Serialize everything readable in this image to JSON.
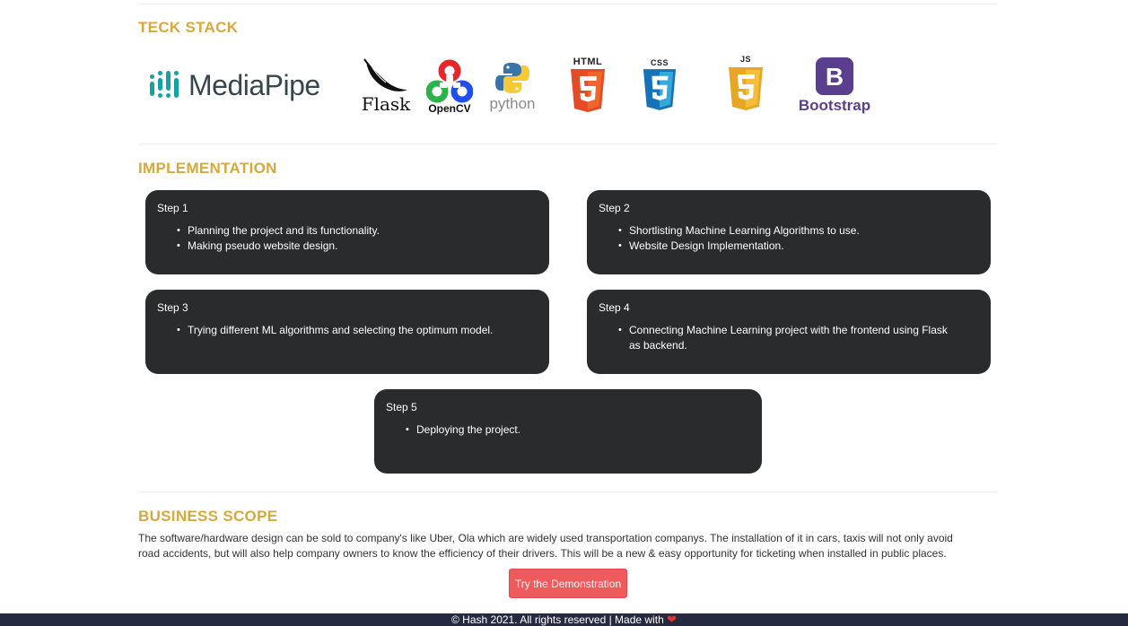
{
  "tech_stack": {
    "title": "TECK STACK",
    "logos": [
      {
        "name": "MediaPipe",
        "icon": "mediapipe-logo"
      },
      {
        "name": "Flask",
        "icon": "flask-logo"
      },
      {
        "name": "OpenCV",
        "icon": "opencv-logo"
      },
      {
        "name": "python",
        "icon": "python-logo"
      },
      {
        "name": "HTML",
        "icon": "html5-logo"
      },
      {
        "name": "CSS",
        "icon": "css3-logo"
      },
      {
        "name": "JS",
        "icon": "js-logo"
      },
      {
        "name": "Bootstrap",
        "icon": "bootstrap-logo"
      }
    ]
  },
  "implementation": {
    "title": "IMPLEMENTATION",
    "steps": [
      {
        "title": "Step 1",
        "items": [
          "Planning the project and its functionality.",
          "Making pseudo website design."
        ]
      },
      {
        "title": "Step 2",
        "items": [
          "Shortlisting Machine Learning Algorithms to use.",
          "Website Design Implementation."
        ]
      },
      {
        "title": "Step 3",
        "items": [
          "Trying different ML algorithms and selecting the optimum model."
        ]
      },
      {
        "title": "Step 4",
        "items": [
          "Connecting Machine Learning project with the frontend using Flask as backend."
        ]
      },
      {
        "title": "Step 5",
        "items": [
          "Deploying the project."
        ]
      }
    ]
  },
  "business_scope": {
    "title": "BUSINESS SCOPE",
    "text": "The software/hardware design can be sold to company's like Uber, Ola which are widely used transportation companys. The installation of it in cars, taxis will not only avoid road accidents, but will also help company owners to know the efficiency of their drivers. This will be a new & easy opportunity for ticketing when installed in public places.",
    "button_label": "Try the Demonstration"
  },
  "footer": {
    "text": "© Hash 2021. All rights reserved | Made with",
    "heart": "❤"
  },
  "colors": {
    "accent": "#d9a83b",
    "card": "#292b2c",
    "button": "#ef5a5d",
    "footer": "#262a40"
  }
}
